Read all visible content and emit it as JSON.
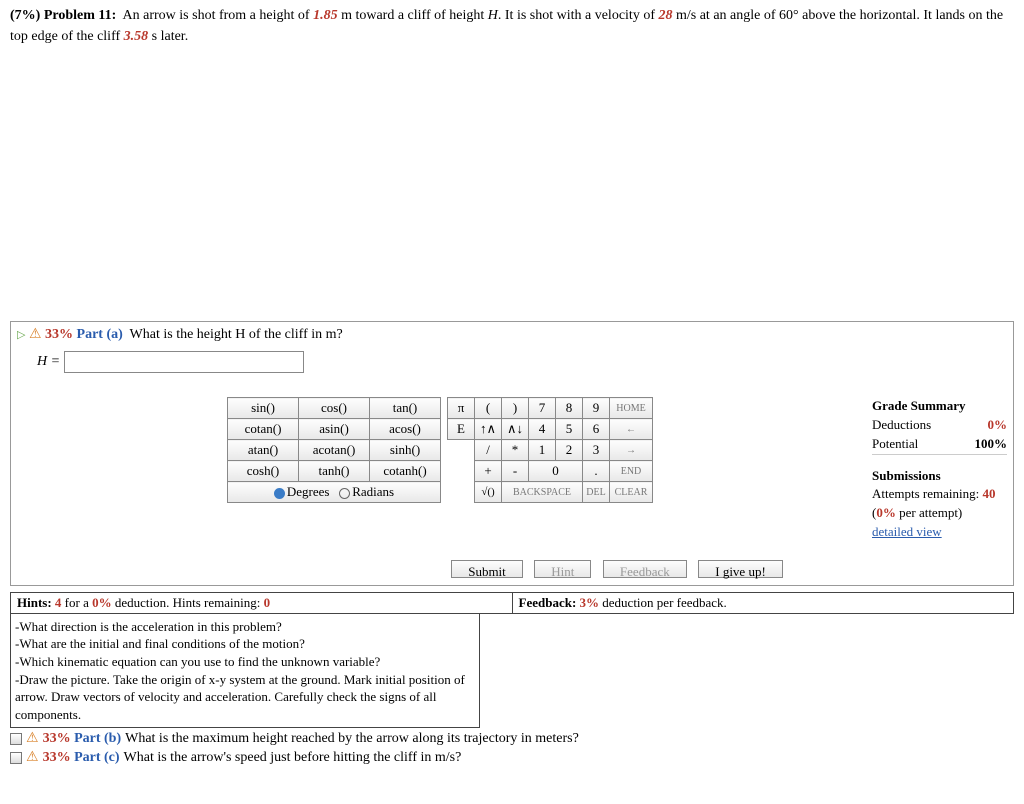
{
  "problem": {
    "pct": "(7%)",
    "label": "Problem 11:",
    "t1": "An arrow is shot from a height of ",
    "h0": "1.85",
    "t2": " m toward a cliff of height ",
    "Hvar": "H",
    "t3": ". It is shot with a velocity of ",
    "v0": "28",
    "t4": " m/s at an angle of 60° above the horizontal. It lands on the top edge of the cliff ",
    "tland": "3.58",
    "t5": " s later."
  },
  "partA": {
    "pct": "33%",
    "label": "Part (a)",
    "q": "What is the height H of the cliff in m?",
    "eqlabel": "H =",
    "input_value": ""
  },
  "funcpad": {
    "r1": [
      "sin()",
      "cos()",
      "tan()"
    ],
    "r2": [
      "cotan()",
      "asin()",
      "acos()"
    ],
    "r3": [
      "atan()",
      "acotan()",
      "sinh()"
    ],
    "r4": [
      "cosh()",
      "tanh()",
      "cotanh()"
    ],
    "deg": "Degrees",
    "rad": "Radians"
  },
  "numpad": {
    "r1a": [
      "π",
      "(",
      ")"
    ],
    "r1b": [
      "7",
      "8",
      "9"
    ],
    "r1c": "HOME",
    "r2a": [
      "E",
      "↑∧",
      "∧↓"
    ],
    "r2b": [
      "4",
      "5",
      "6"
    ],
    "r2c": "←",
    "r3a": [
      "/",
      "*"
    ],
    "r3b": [
      "1",
      "2",
      "3"
    ],
    "r3c": "→",
    "r4a": [
      "+",
      "-"
    ],
    "r4b": [
      "0",
      "."
    ],
    "r4c": "END",
    "r5a": "√()",
    "r5b": "BACKSPACE",
    "r5c": "DEL",
    "r5d": "CLEAR"
  },
  "actions": {
    "submit": "Submit",
    "hint": "Hint",
    "feedback": "Feedback",
    "giveup": "I give up!"
  },
  "summary": {
    "hdr1": "Grade Summary",
    "ded_l": "Deductions",
    "ded_v": "0%",
    "pot_l": "Potential",
    "pot_v": "100%",
    "hdr2": "Submissions",
    "att_l": "Attempts remaining:",
    "att_v": "40",
    "per_l": "(",
    "per_v": "0%",
    "per_r": " per attempt)",
    "link": "detailed view"
  },
  "hintsbar": {
    "left1": "Hints: ",
    "left_n": "4",
    "left2": " for a ",
    "left_p": "0%",
    "left3": " deduction. Hints remaining: ",
    "left_r": "0",
    "right1": "Feedback: ",
    "right_p": "3%",
    "right2": " deduction per feedback."
  },
  "hintlist": [
    "-What direction is the acceleration in this problem?",
    "-What are the initial and final conditions of the motion?",
    "-Which kinematic equation can you use to find the unknown variable?",
    "-Draw the picture. Take the origin of x-y system at the ground. Mark initial position of arrow. Draw vectors of velocity and acceleration. Carefully check the signs of all components."
  ],
  "partB": {
    "pct": "33%",
    "label": "Part (b)",
    "q": "What is the maximum height reached by the arrow along its trajectory in meters?"
  },
  "partC": {
    "pct": "33%",
    "label": "Part (c)",
    "q": "What is the arrow's speed just before hitting the cliff in m/s?"
  }
}
